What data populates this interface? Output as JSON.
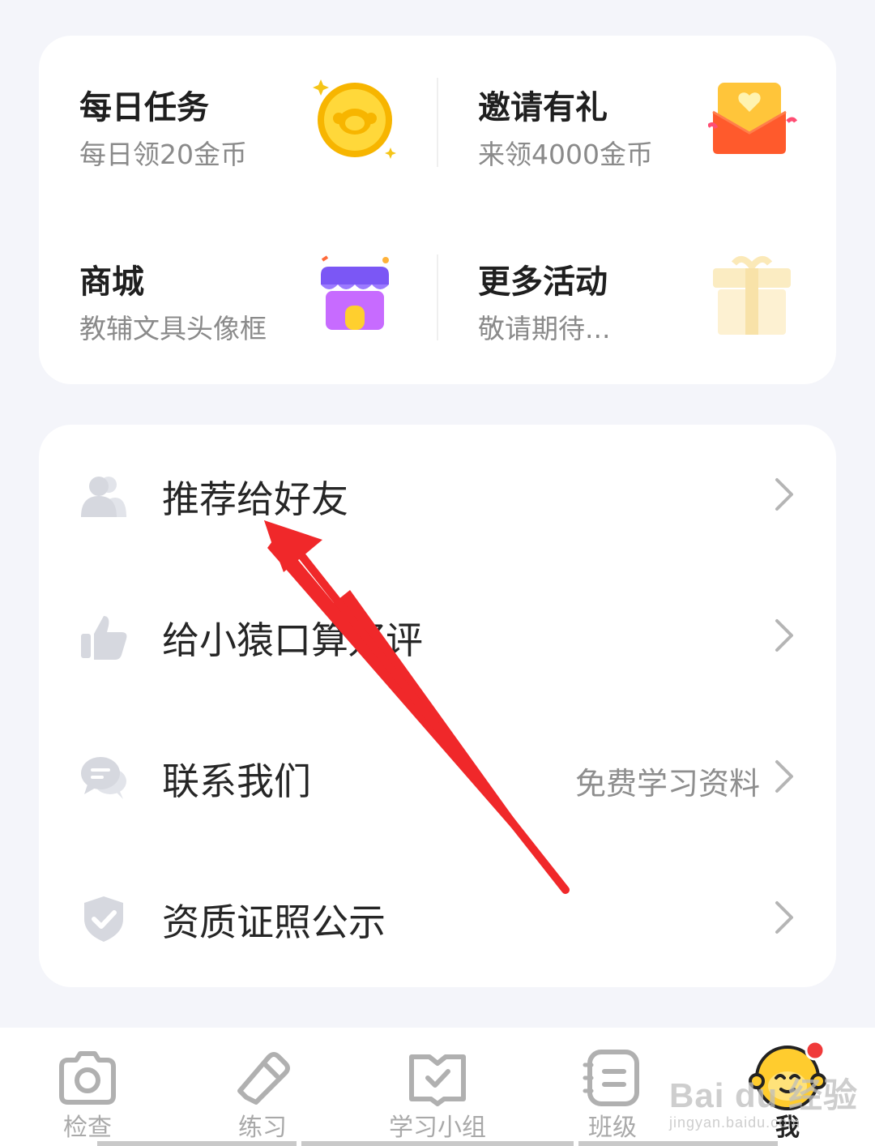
{
  "activity_tiles": [
    {
      "title": "每日任务",
      "subtitle": "每日领20金币",
      "icon": "coin-icon"
    },
    {
      "title": "邀请有礼",
      "subtitle": "来领4000金币",
      "icon": "envelope-heart-icon"
    },
    {
      "title": "商城",
      "subtitle": "教辅文具头像框",
      "icon": "shop-icon"
    },
    {
      "title": "更多活动",
      "subtitle": "敬请期待...",
      "icon": "gift-icon"
    }
  ],
  "menu": [
    {
      "label": "推荐给好友",
      "icon": "users-icon",
      "extra": ""
    },
    {
      "label": "给小猿口算好评",
      "icon": "thumbs-up-icon",
      "extra": ""
    },
    {
      "label": "联系我们",
      "icon": "chat-bubble-icon",
      "extra": "免费学习资料"
    },
    {
      "label": "资质证照公示",
      "icon": "shield-check-icon",
      "extra": ""
    }
  ],
  "tabs": [
    {
      "label": "检查",
      "icon": "camera-icon",
      "active": false
    },
    {
      "label": "练习",
      "icon": "pencil-icon",
      "active": false
    },
    {
      "label": "学习小组",
      "icon": "book-check-icon",
      "active": false
    },
    {
      "label": "班级",
      "icon": "class-list-icon",
      "active": false
    },
    {
      "label": "我",
      "icon": "monkey-avatar-icon",
      "active": true,
      "badge": "red-dot"
    }
  ],
  "watermark": {
    "main": "Bai du 经验",
    "sub": "jingyan.baidu.com"
  },
  "colors": {
    "background": "#f4f5fa",
    "card": "#ffffff",
    "annotation_arrow": "#f0282a",
    "badge": "#f03a3a"
  }
}
